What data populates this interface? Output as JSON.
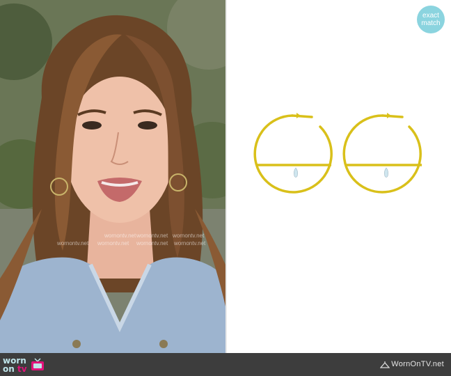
{
  "badge": {
    "line1": "exact",
    "line2": "match"
  },
  "footer": {
    "logo_top": "worn",
    "logo_bottom": "on",
    "logo_tv": "tv",
    "site": "WornOnTV.net"
  },
  "watermark": "wornontv.net",
  "colors": {
    "badge": "#8bd4df",
    "footer_bg": "#3d3d3d",
    "gold": "#d9c01a",
    "logo_pink": "#e1127a"
  }
}
